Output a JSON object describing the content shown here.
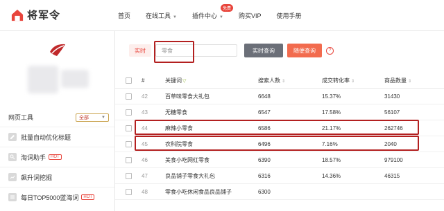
{
  "header": {
    "brand": "将军令",
    "nav": [
      {
        "label": "首页",
        "has_caret": false,
        "badge": ""
      },
      {
        "label": "在线工具",
        "has_caret": true,
        "badge": ""
      },
      {
        "label": "插件中心",
        "has_caret": true,
        "badge": "免费"
      },
      {
        "label": "购买VIP",
        "has_caret": false,
        "badge": ""
      },
      {
        "label": "使用手册",
        "has_caret": false,
        "badge": ""
      }
    ]
  },
  "sidebar": {
    "section_label": "网页工具",
    "filter_value": "全部",
    "items": [
      {
        "label": "批量自动优化标题",
        "icon": "edit-icon",
        "tag": ""
      },
      {
        "label": "淘词助手",
        "icon": "key-icon",
        "tag": "HOT"
      },
      {
        "label": "飙升词挖掘",
        "icon": "chart-icon",
        "tag": ""
      },
      {
        "label": "每日TOP5000蓝海词",
        "icon": "list-icon",
        "tag": "HOT"
      }
    ]
  },
  "search": {
    "mode_label": "实时",
    "value": "零食",
    "query_button": "实时查询",
    "random_button": "随便查询"
  },
  "table": {
    "headers": {
      "num": "#",
      "keyword": "关键词",
      "searchers": "搜索人数",
      "conversion": "成交转化率",
      "goods": "商品数量"
    },
    "rows": [
      {
        "num": "42",
        "keyword": "百草味零食大礼包",
        "searchers": "6648",
        "conversion": "15.37%",
        "goods": "31430",
        "highlight": false
      },
      {
        "num": "43",
        "keyword": "无糖零食",
        "searchers": "6547",
        "conversion": "17.58%",
        "goods": "56107",
        "highlight": false
      },
      {
        "num": "44",
        "keyword": "麻辣小零食",
        "searchers": "6586",
        "conversion": "21.17%",
        "goods": "262746",
        "highlight": true
      },
      {
        "num": "45",
        "keyword": "农科院零食",
        "searchers": "6496",
        "conversion": "7.16%",
        "goods": "2040",
        "highlight": true
      },
      {
        "num": "46",
        "keyword": "美食小吃网红零食",
        "searchers": "6390",
        "conversion": "18.57%",
        "goods": "979100",
        "highlight": false
      },
      {
        "num": "47",
        "keyword": "良品铺子零食大礼包",
        "searchers": "6316",
        "conversion": "14.36%",
        "goods": "46315",
        "highlight": false
      },
      {
        "num": "48",
        "keyword": "零食小吃休闲食品良品铺子",
        "searchers": "6300",
        "conversion": "",
        "goods": "",
        "highlight": false
      }
    ]
  },
  "colors": {
    "accent": "#e8453c",
    "highlight_border": "#b32020",
    "query_btn": "#6b6f78",
    "random_btn": "#f26b4e"
  }
}
